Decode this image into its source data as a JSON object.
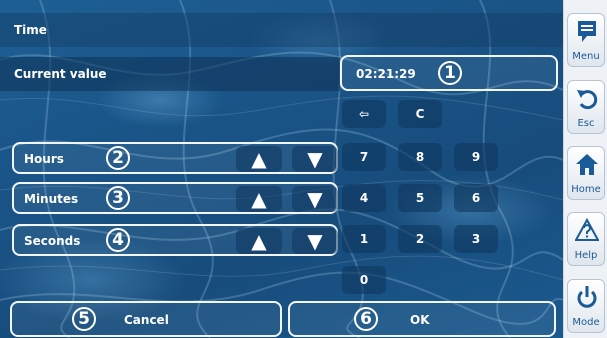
{
  "title": "Time",
  "current_value": {
    "label": "Current value",
    "value": "02:21:29",
    "callout": "1"
  },
  "rows": [
    {
      "label": "Hours",
      "callout": "2",
      "up": "▲",
      "down": "▼"
    },
    {
      "label": "Minutes",
      "callout": "3",
      "up": "▲",
      "down": "▼"
    },
    {
      "label": "Seconds",
      "callout": "4",
      "up": "▲",
      "down": "▼"
    }
  ],
  "keypad": {
    "backspace": "⇦",
    "clear": "C",
    "digits": [
      "7",
      "8",
      "9",
      "4",
      "5",
      "6",
      "1",
      "2",
      "3",
      "0"
    ]
  },
  "footer": {
    "cancel": {
      "label": "Cancel",
      "callout": "5"
    },
    "ok": {
      "label": "OK",
      "callout": "6"
    }
  },
  "sidebar": [
    {
      "label": "Menu",
      "icon": "menu-icon"
    },
    {
      "label": "Esc",
      "icon": "escape-icon"
    },
    {
      "label": "Home",
      "icon": "home-icon"
    },
    {
      "label": "Help",
      "icon": "help-icon"
    },
    {
      "label": "Mode",
      "icon": "power-icon"
    }
  ],
  "colors": {
    "background": "#1a5487",
    "frame": "#f2f6fa",
    "sidebar_accent": "#1a5a96"
  }
}
